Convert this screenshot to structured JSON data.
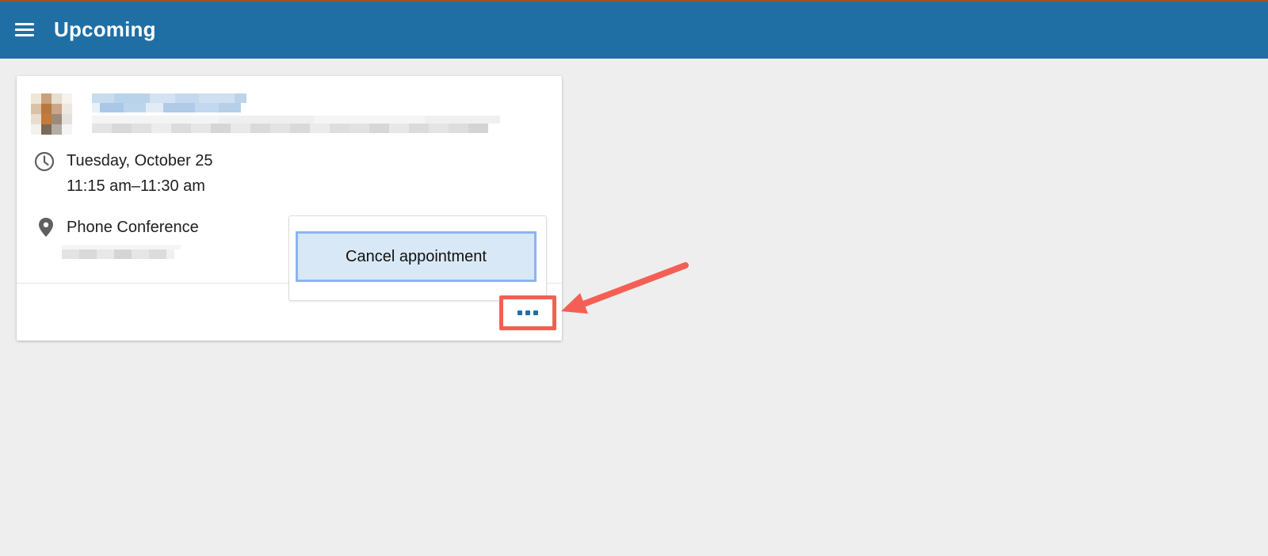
{
  "appbar": {
    "title": "Upcoming",
    "menu_icon": "hamburger-menu-icon",
    "color": "#1f6fa5"
  },
  "appointment": {
    "date": "Tuesday, October 25",
    "time": "11:15 am–11:30 am",
    "location": "Phone Conference",
    "clock_icon": "clock-icon",
    "location_icon": "map-pin-icon"
  },
  "menu": {
    "cancel_label": "Cancel appointment"
  },
  "more_button": {
    "icon": "more-dots-icon"
  },
  "annotation": {
    "highlight_color": "#f45f55",
    "arrow_icon": "pointer-arrow-icon"
  }
}
